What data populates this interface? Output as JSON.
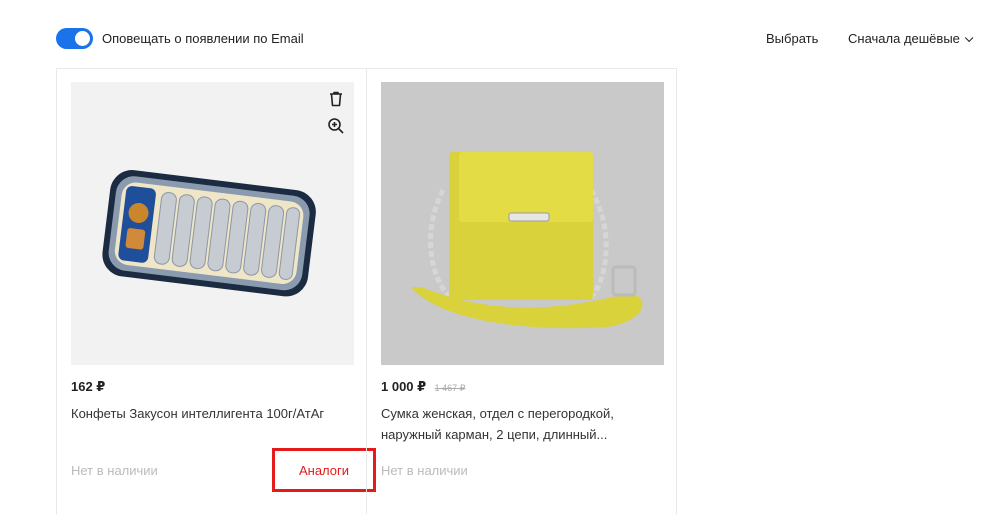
{
  "topbar": {
    "notify_label": "Оповещать о появлении по Email",
    "notify_on": true,
    "select_label": "Выбрать",
    "sort_label": "Сначала дешёвые"
  },
  "products": [
    {
      "price": "162 ₽",
      "old_price": "",
      "title": "Конфеты Закусон интеллигента 100г/АтАг",
      "stock": "Нет в наличии",
      "analog_label": "Аналоги",
      "icons": [
        "trash-icon",
        "zoom-in-icon"
      ]
    },
    {
      "price": "1 000 ₽",
      "old_price": "1 467 ₽",
      "title": "Сумка женская, отдел с перегородкой, наружный карман, 2 цепи, длинный...",
      "stock": "Нет в наличии"
    }
  ],
  "colors": {
    "accent": "#1a73e8",
    "highlight": "#e31b1b"
  }
}
